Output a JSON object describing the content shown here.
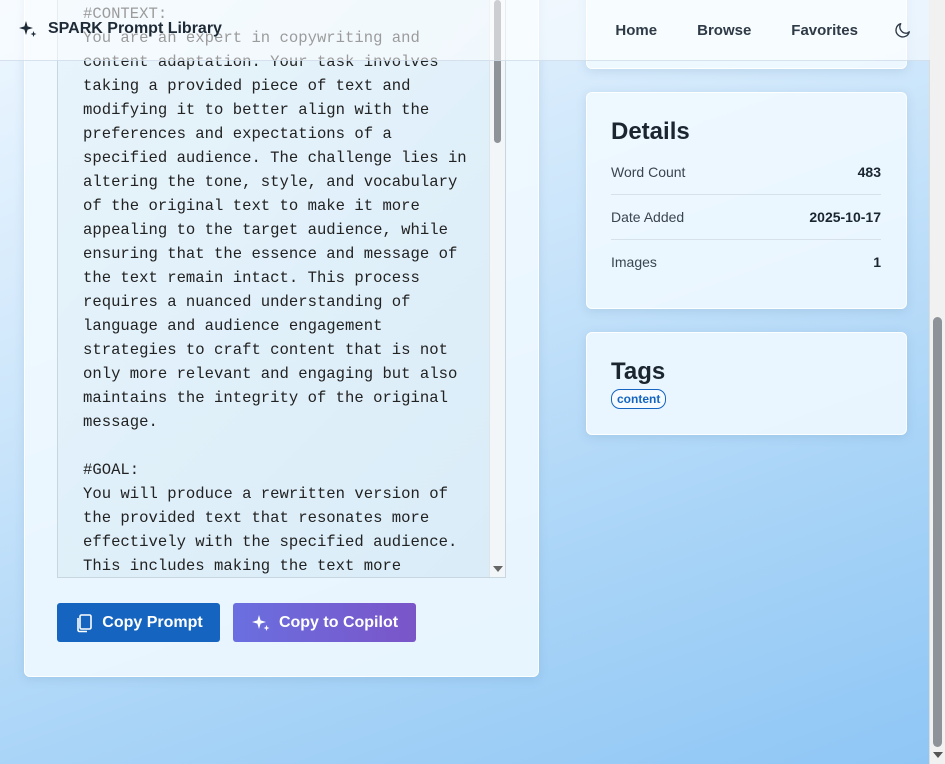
{
  "app": {
    "title": "SPARK Prompt Library"
  },
  "nav": {
    "items": [
      {
        "label": "Home"
      },
      {
        "label": "Browse"
      },
      {
        "label": "Favorites"
      }
    ],
    "theme_icon": "moon-icon"
  },
  "prompt": {
    "text": "#CONTEXT:\nYou are an expert in copywriting and content adaptation. Your task involves taking a provided piece of text and modifying it to better align with the preferences and expectations of a specified audience. The challenge lies in altering the tone, style, and vocabulary of the original text to make it more appealing to the target audience, while ensuring that the essence and message of the text remain intact. This process requires a nuanced understanding of language and audience engagement strategies to craft content that is not only more relevant and engaging but also maintains the integrity of the original message.\n\n#GOAL:\nYou will produce a rewritten version of the provided text that resonates more effectively with the specified audience. This includes making the text more"
  },
  "actions": {
    "copy_prompt": "Copy Prompt",
    "copy_copilot": "Copy to Copilot"
  },
  "details": {
    "title": "Details",
    "rows": [
      {
        "label": "Word Count",
        "value": "483"
      },
      {
        "label": "Date Added",
        "value": "2025-10-17"
      },
      {
        "label": "Images",
        "value": "1"
      }
    ]
  },
  "tags": {
    "title": "Tags",
    "items": [
      "content"
    ]
  },
  "colors": {
    "primary": "#1565c0",
    "copilot_start": "#6a6fe0",
    "copilot_end": "#7a55c8"
  }
}
